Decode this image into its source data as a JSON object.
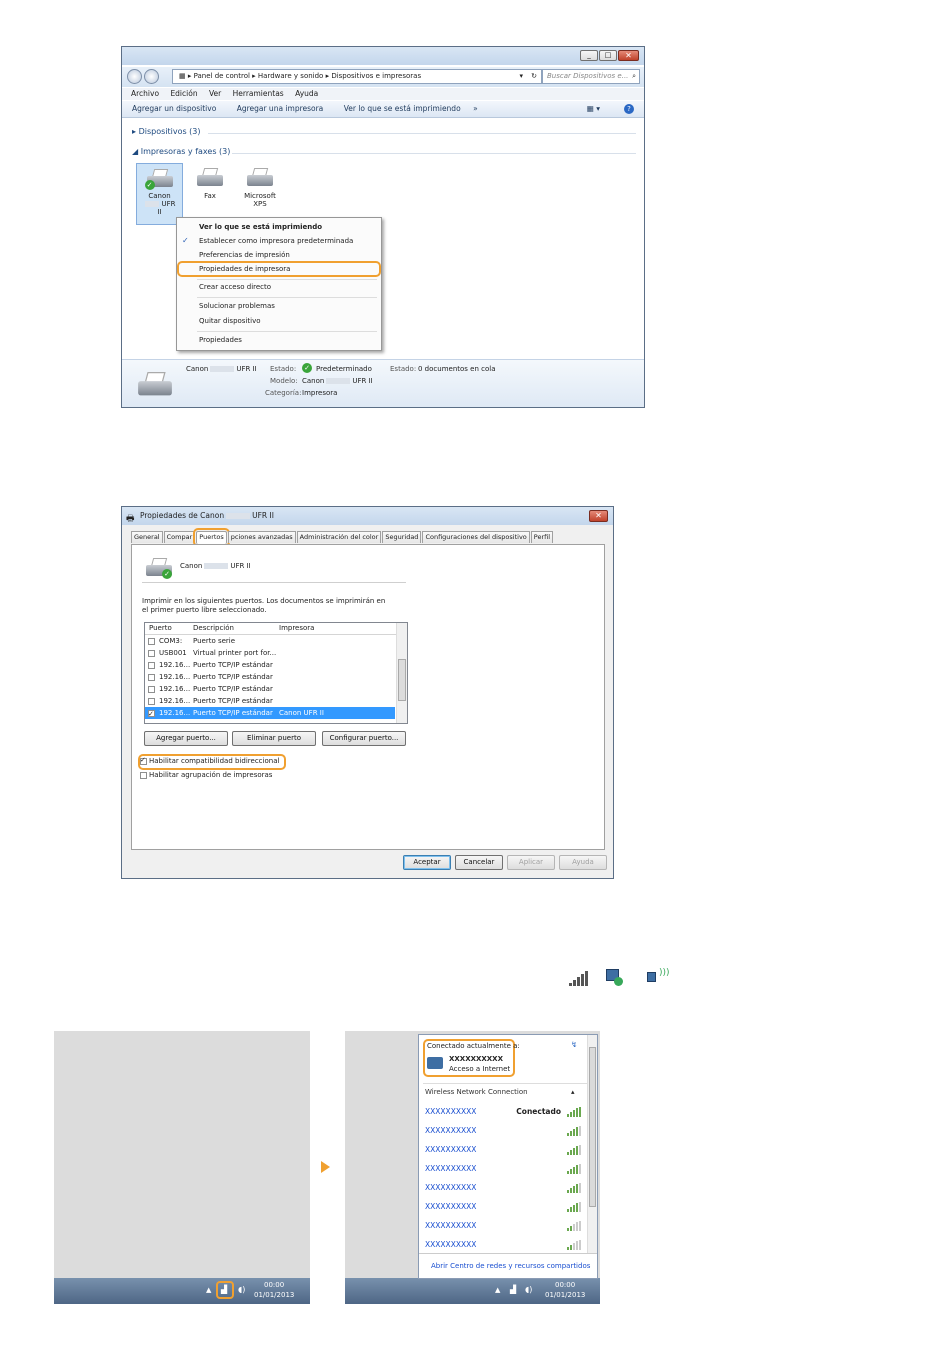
{
  "window1": {
    "breadcrumb": [
      "Panel de control",
      "Hardware y sonido",
      "Dispositivos e impresoras"
    ],
    "search_placeholder": "Buscar Dispositivos e...",
    "menu": [
      "Archivo",
      "Edición",
      "Ver",
      "Herramientas",
      "Ayuda"
    ],
    "commands": [
      "Agregar un dispositivo",
      "Agregar una impresora",
      "Ver lo que se está imprimiendo",
      "»"
    ],
    "section_devices": "Dispositivos (3)",
    "section_printers": "Impresoras y faxes (3)",
    "devices": [
      {
        "line1": "Canon",
        "line2": "UFR",
        "line3": "II"
      },
      {
        "line1": "Fax",
        "line2": "",
        "line3": ""
      },
      {
        "line1": "Microsoft",
        "line2": "XPS",
        "line3": ""
      }
    ],
    "context_menu": {
      "header": "Ver lo que se está imprimiendo",
      "items": [
        "Establecer como impresora predeterminada",
        "Preferencias de impresión",
        "Propiedades de impresora",
        "Crear acceso directo",
        "Solucionar problemas",
        "Quitar dispositivo",
        "Propiedades"
      ],
      "checked_index": 0,
      "highlighted_index": 2
    },
    "status": {
      "name_prefix": "Canon",
      "name_suffix": "UFR II",
      "estado_label": "Estado:",
      "estado_value": "Predeterminado",
      "modelo_label": "Modelo:",
      "modelo_value_prefix": "Canon",
      "modelo_value_suffix": "UFR II",
      "categoria_label": "Categoría:",
      "categoria_value": "Impresora",
      "estado2_label": "Estado:",
      "estado2_value": "0 documentos en cola"
    }
  },
  "window2": {
    "title_prefix": "Propiedades de Canon",
    "title_suffix": "UFR II",
    "tabs": [
      "General",
      "Compar",
      "Puertos",
      "pciones avanzadas",
      "Administración del color",
      "Seguridad",
      "Configuraciones del dispositivo",
      "Perfil"
    ],
    "selected_tab": "Puertos",
    "printer_name_prefix": "Canon",
    "printer_name_suffix": "UFR II",
    "instruction": "Imprimir en los siguientes puertos. Los documentos se imprimirán en el primer puerto libre seleccionado.",
    "columns": [
      "Puerto",
      "Descripción",
      "Impresora"
    ],
    "rows": [
      {
        "port": "COM3:",
        "desc": "Puerto serie",
        "printer": "",
        "checked": false
      },
      {
        "port": "USB001",
        "desc": "Virtual printer port for...",
        "printer": "",
        "checked": false
      },
      {
        "port": "192.16...",
        "desc": "Puerto TCP/IP estándar",
        "printer": "",
        "checked": false
      },
      {
        "port": "192.16...",
        "desc": "Puerto TCP/IP estándar",
        "printer": "",
        "checked": false
      },
      {
        "port": "192.16...",
        "desc": "Puerto TCP/IP estándar",
        "printer": "",
        "checked": false
      },
      {
        "port": "192.16...",
        "desc": "Puerto TCP/IP estándar",
        "printer": "",
        "checked": false
      },
      {
        "port": "192.16...",
        "desc": "Puerto TCP/IP estándar",
        "printer": "Canon UFR II",
        "checked": true
      }
    ],
    "buttons": [
      "Agregar puerto...",
      "Eliminar puerto",
      "Configurar puerto..."
    ],
    "bidirectional": "Habilitar compatibilidad bidireccional",
    "pooling": "Habilitar agrupación de impresoras",
    "footer_buttons": [
      "Aceptar",
      "Cancelar",
      "Aplicar",
      "Ayuda"
    ]
  },
  "network": {
    "connected_header": "Conectado actualmente a:",
    "network_name": "XXXXXXXXXX",
    "network_access": "Acceso a Internet",
    "wireless_label": "Wireless Network Connection",
    "networks": [
      {
        "name": "XXXXXXXXXX",
        "status": "Conectado"
      },
      {
        "name": "XXXXXXXXXX",
        "status": ""
      },
      {
        "name": "XXXXXXXXXX",
        "status": ""
      },
      {
        "name": "XXXXXXXXXX",
        "status": ""
      },
      {
        "name": "XXXXXXXXXX",
        "status": ""
      },
      {
        "name": "XXXXXXXXXX",
        "status": ""
      },
      {
        "name": "XXXXXXXXXX",
        "status": ""
      },
      {
        "name": "XXXXXXXXXX",
        "status": ""
      }
    ],
    "footer_link": "Abrir Centro de redes y recursos compartidos",
    "clock_time": "00:00",
    "clock_date": "01/01/2013"
  },
  "colors": {
    "highlight": "#f0a030",
    "arrow": "#f0a030",
    "selection": "#3399ff",
    "link": "#1a4fd0"
  }
}
